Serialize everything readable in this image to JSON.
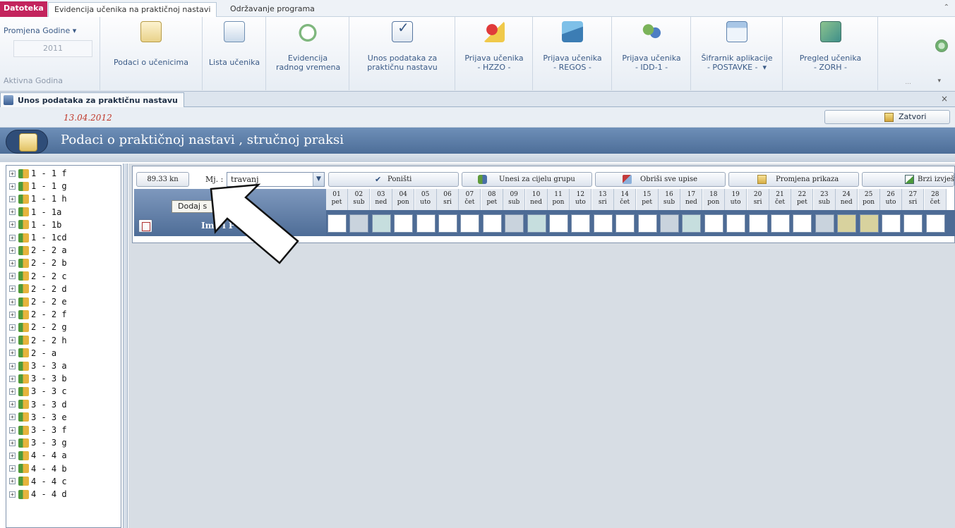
{
  "ribbon": {
    "tabs": [
      {
        "label": "Datoteka"
      },
      {
        "label": "Evidencija učenika na praktičnoj nastavi"
      },
      {
        "label": "Održavanje programa"
      }
    ],
    "collapse_icon": "chevron-up-icon",
    "year_label": "Promjena  Godine ▾",
    "year_value": "2011",
    "year_group_caption": "Aktivna Godina",
    "buttons": [
      {
        "label": "Podaci o učenicima",
        "icon": "students-card-icon"
      },
      {
        "label": "Lista učenika",
        "icon": "student-list-icon"
      },
      {
        "label": "Evidencija\nradnog vremena",
        "icon": "work-time-icon"
      },
      {
        "label": "Unos podataka za\npraktičnu nastavu",
        "icon": "checkbox-icon"
      },
      {
        "label": "Prijava učenika\n- HZZO -",
        "icon": "award-envelope-icon"
      },
      {
        "label": "Prijava učenika\n- REGOS -",
        "icon": "stack-icon"
      },
      {
        "label": "Prijava učenika\n- IDD-1 -",
        "icon": "group-icon"
      },
      {
        "label": "Šifrarnik aplikacije\n- POSTAVKE -  ▾",
        "icon": "settings-window-icon"
      },
      {
        "label": "Pregled učenika\n- ZORH -",
        "icon": "map-icon"
      }
    ]
  },
  "document_tab": {
    "title": "Unos podataka za praktičnu nastavu",
    "close": "×"
  },
  "form": {
    "date": "13.04.2012",
    "close_button": "Zatvori",
    "title": "Podaci o praktičnoj nastavi , stručnoj praksi"
  },
  "tree": {
    "items": [
      "1 - 1 f",
      "1 - 1 g",
      "1 - 1 h",
      "1 - 1a",
      "1 - 1b",
      "1 - 1cd",
      "2 - 2 a",
      "2 - 2 b",
      "2 - 2 c",
      "2 - 2 d",
      "2 - 2 e",
      "2 - 2 f",
      "2 - 2 g",
      "2 - 2 h",
      "2 - a",
      "3 - 3 a",
      "3 - 3 b",
      "3 - 3 c",
      "3 - 3 d",
      "3 - 3 e",
      "3 - 3 f",
      "3 - 3 g",
      "4 - 4 a",
      "4 - 4 b",
      "4 - 4 c",
      "4 - 4 d"
    ]
  },
  "toolbar": {
    "amount": "89.33 kn",
    "month_label": "Mj. :",
    "month_value": "travanj",
    "buttons": [
      {
        "label": "Poništi",
        "icon": "checkmark-icon"
      },
      {
        "label": "Unesi za cijelu grupu",
        "icon": "group-add-icon"
      },
      {
        "label": "Obriši sve upise",
        "icon": "erase-icon"
      },
      {
        "label": "Promjena prikaza",
        "icon": "folder-view-icon"
      },
      {
        "label": "Brzi izvještaj",
        "icon": "report-icon"
      }
    ]
  },
  "grid": {
    "tooltip": "Dodaj s",
    "name_header": "Ime i P",
    "days": [
      {
        "num": "01",
        "day": "pet"
      },
      {
        "num": "02",
        "day": "sub"
      },
      {
        "num": "03",
        "day": "ned"
      },
      {
        "num": "04",
        "day": "pon"
      },
      {
        "num": "05",
        "day": "uto"
      },
      {
        "num": "06",
        "day": "sri"
      },
      {
        "num": "07",
        "day": "čet"
      },
      {
        "num": "08",
        "day": "pet"
      },
      {
        "num": "09",
        "day": "sub"
      },
      {
        "num": "10",
        "day": "ned"
      },
      {
        "num": "11",
        "day": "pon"
      },
      {
        "num": "12",
        "day": "uto"
      },
      {
        "num": "13",
        "day": "sri"
      },
      {
        "num": "14",
        "day": "čet"
      },
      {
        "num": "15",
        "day": "pet"
      },
      {
        "num": "16",
        "day": "sub"
      },
      {
        "num": "17",
        "day": "ned"
      },
      {
        "num": "18",
        "day": "pon"
      },
      {
        "num": "19",
        "day": "uto"
      },
      {
        "num": "20",
        "day": "sri"
      },
      {
        "num": "21",
        "day": "čet"
      },
      {
        "num": "22",
        "day": "pet"
      },
      {
        "num": "23",
        "day": "sub"
      },
      {
        "num": "24",
        "day": "ned"
      },
      {
        "num": "25",
        "day": "pon"
      },
      {
        "num": "26",
        "day": "uto"
      },
      {
        "num": "27",
        "day": "sri"
      },
      {
        "num": "28",
        "day": "čet"
      }
    ],
    "cell_colors": {
      "weekday": "#ffffff",
      "saturday": "#c9d3dd",
      "sunday": "#c6dede",
      "holiday": "#d8d29e"
    },
    "cell_kinds": [
      "weekday",
      "saturday",
      "sunday",
      "weekday",
      "weekday",
      "weekday",
      "weekday",
      "weekday",
      "saturday",
      "sunday",
      "weekday",
      "weekday",
      "weekday",
      "weekday",
      "weekday",
      "saturday",
      "sunday",
      "weekday",
      "weekday",
      "weekday",
      "weekday",
      "weekday",
      "saturday",
      "holiday",
      "holiday",
      "weekday",
      "weekday",
      "weekday"
    ]
  }
}
